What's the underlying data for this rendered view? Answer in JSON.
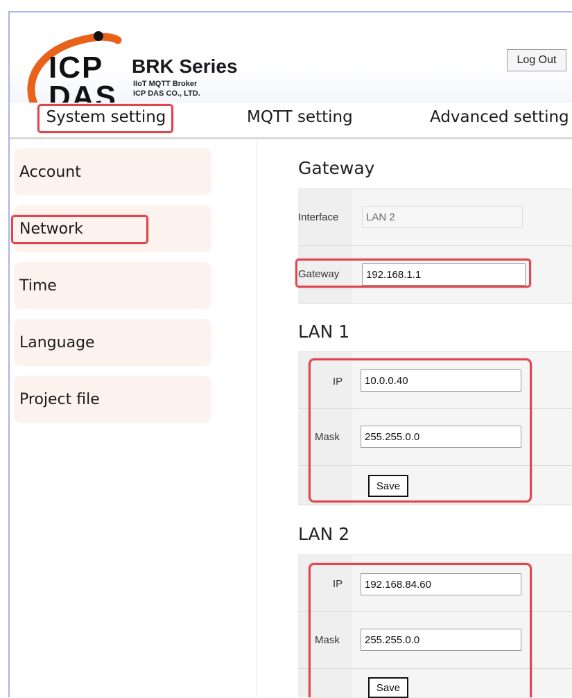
{
  "header": {
    "brand": {
      "logo_line1": "ICP",
      "logo_line2": "DAS",
      "title": "BRK Series",
      "subtitle1": "IIoT MQTT Broker",
      "subtitle2": "ICP DAS CO., LTD."
    },
    "logout_label": "Log Out"
  },
  "nav": {
    "tabs": [
      {
        "label": "System setting",
        "active": true
      },
      {
        "label": "MQTT setting"
      },
      {
        "label": "Advanced setting"
      }
    ]
  },
  "sidebar": {
    "items": [
      {
        "label": "Account"
      },
      {
        "label": "Network",
        "active": true
      },
      {
        "label": "Time"
      },
      {
        "label": "Language"
      },
      {
        "label": "Project file"
      }
    ]
  },
  "gateway": {
    "title": "Gateway",
    "interface_label": "Interface",
    "interface_value": "LAN 2",
    "gateway_label": "Gateway",
    "gateway_value": "192.168.1.1"
  },
  "lan1": {
    "title": "LAN 1",
    "ip_label": "IP",
    "ip_value": "10.0.0.40",
    "mask_label": "Mask",
    "mask_value": "255.255.0.0",
    "save_label": "Save"
  },
  "lan2": {
    "title": "LAN 2",
    "ip_label": "IP",
    "ip_value": "192.168.84.60",
    "mask_label": "Mask",
    "mask_value": "255.255.0.0",
    "save_label": "Save"
  },
  "colors": {
    "highlight": "#e0454f",
    "sidebar_bg": "#fdf3ee",
    "logo_arc": "#e8621c",
    "window_border": "#a9b5e6"
  }
}
